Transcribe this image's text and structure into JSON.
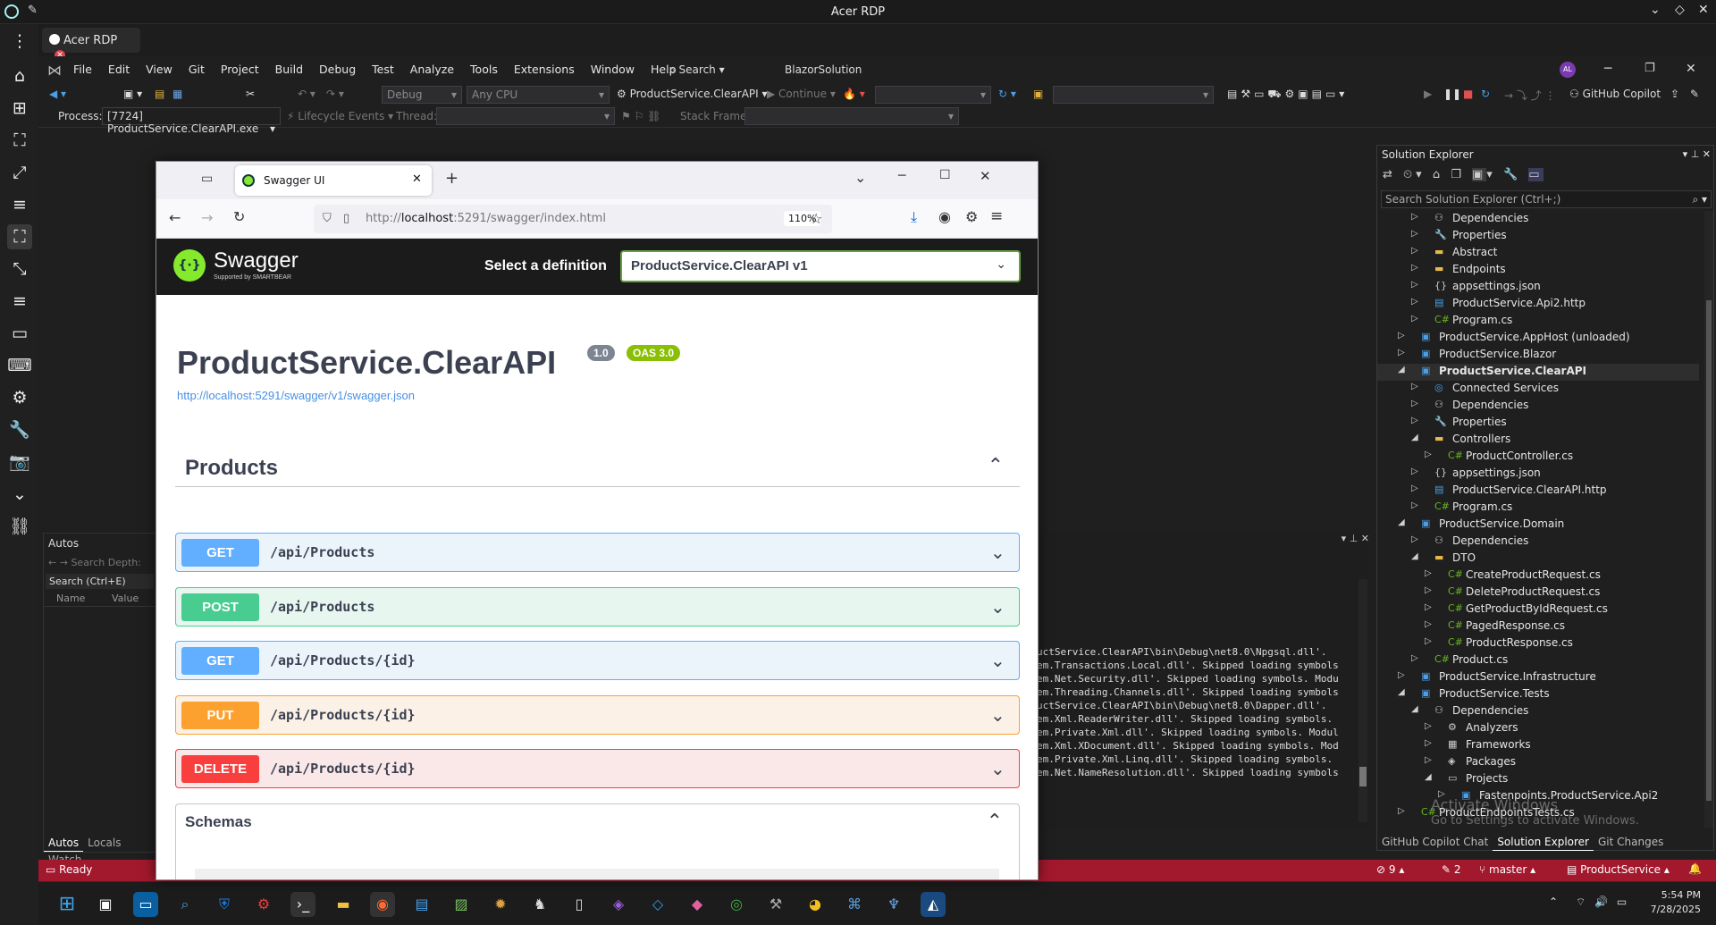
{
  "rdp": {
    "title": "Acer RDP",
    "tab_label": "Acer RDP"
  },
  "vs": {
    "menu": [
      "File",
      "Edit",
      "View",
      "Git",
      "Project",
      "Build",
      "Debug",
      "Test",
      "Analyze",
      "Tools",
      "Extensions",
      "Window",
      "Help"
    ],
    "search_label": "Search",
    "solution_name": "BlazorSolution",
    "avatar_initials": "AL",
    "config": "Debug",
    "platform": "Any CPU",
    "startup_project": "ProductService.ClearAPI",
    "continue_label": "Continue",
    "copilot_label": "GitHub Copilot",
    "process_label": "Process:",
    "process_value": "[7724] ProductService.ClearAPI.exe",
    "lifecycle_label": "Lifecycle Events",
    "thread_label": "Thread:",
    "stack_label": "Stack Frame:"
  },
  "solution_explorer": {
    "title": "Solution Explorer",
    "search_placeholder": "Search Solution Explorer (Ctrl+;)",
    "items": [
      {
        "label": "Dependencies",
        "depth": 2,
        "icon": "dependencies-icon"
      },
      {
        "label": "Properties",
        "depth": 2,
        "icon": "properties-icon"
      },
      {
        "label": "Abstract",
        "depth": 2,
        "icon": "folder-icon"
      },
      {
        "label": "Endpoints",
        "depth": 2,
        "icon": "folder-icon"
      },
      {
        "label": "appsettings.json",
        "depth": 2,
        "icon": "json-file-icon"
      },
      {
        "label": "ProductService.Api2.http",
        "depth": 2,
        "icon": "http-file-icon"
      },
      {
        "label": "Program.cs",
        "depth": 2,
        "icon": "csharp-file-icon"
      },
      {
        "label": "ProductService.AppHost (unloaded)",
        "depth": 1,
        "icon": "project-icon"
      },
      {
        "label": "ProductService.Blazor",
        "depth": 1,
        "icon": "project-icon"
      },
      {
        "label": "ProductService.ClearAPI",
        "depth": 1,
        "icon": "project-icon",
        "selected": true
      },
      {
        "label": "Connected Services",
        "depth": 2,
        "icon": "connected-services-icon"
      },
      {
        "label": "Dependencies",
        "depth": 2,
        "icon": "dependencies-icon"
      },
      {
        "label": "Properties",
        "depth": 2,
        "icon": "properties-icon"
      },
      {
        "label": "Controllers",
        "depth": 2,
        "icon": "folder-icon"
      },
      {
        "label": "ProductController.cs",
        "depth": 3,
        "icon": "csharp-file-icon"
      },
      {
        "label": "appsettings.json",
        "depth": 2,
        "icon": "json-file-icon"
      },
      {
        "label": "ProductService.ClearAPI.http",
        "depth": 2,
        "icon": "http-file-icon"
      },
      {
        "label": "Program.cs",
        "depth": 2,
        "icon": "csharp-file-icon"
      },
      {
        "label": "ProductService.Domain",
        "depth": 1,
        "icon": "project-icon"
      },
      {
        "label": "Dependencies",
        "depth": 2,
        "icon": "dependencies-icon"
      },
      {
        "label": "DTO",
        "depth": 2,
        "icon": "folder-icon"
      },
      {
        "label": "CreateProductRequest.cs",
        "depth": 3,
        "icon": "csharp-file-icon"
      },
      {
        "label": "DeleteProductRequest.cs",
        "depth": 3,
        "icon": "csharp-file-icon"
      },
      {
        "label": "GetProductByIdRequest.cs",
        "depth": 3,
        "icon": "csharp-file-icon"
      },
      {
        "label": "PagedResponse.cs",
        "depth": 3,
        "icon": "csharp-file-icon"
      },
      {
        "label": "ProductResponse.cs",
        "depth": 3,
        "icon": "csharp-file-icon"
      },
      {
        "label": "Product.cs",
        "depth": 2,
        "icon": "csharp-file-icon"
      },
      {
        "label": "ProductService.Infrastructure",
        "depth": 1,
        "icon": "project-icon"
      },
      {
        "label": "ProductService.Tests",
        "depth": 1,
        "icon": "project-icon"
      },
      {
        "label": "Dependencies",
        "depth": 2,
        "icon": "dependencies-icon"
      },
      {
        "label": "Analyzers",
        "depth": 3,
        "icon": "analyzer-icon"
      },
      {
        "label": "Frameworks",
        "depth": 3,
        "icon": "framework-icon"
      },
      {
        "label": "Packages",
        "depth": 3,
        "icon": "package-icon"
      },
      {
        "label": "Projects",
        "depth": 3,
        "icon": "projects-icon"
      },
      {
        "label": "Fastenpoints.ProductService.Api2",
        "depth": 4,
        "icon": "project-icon"
      },
      {
        "label": "ProductEndpointsTests.cs",
        "depth": 1,
        "icon": "csharp-file-icon"
      }
    ],
    "watermark_1": "Activate Windows",
    "watermark_2": "Go to Settings to activate Windows.",
    "bottom_tabs": [
      "GitHub Copilot Chat",
      "Solution Explorer",
      "Git Changes"
    ]
  },
  "autos": {
    "title": "Autos",
    "search_depth": "Search Depth:",
    "search": "Search (Ctrl+E)",
    "col_name": "Name",
    "col_value": "Value",
    "tabs": [
      "Autos",
      "Locals",
      "Watch"
    ]
  },
  "output": {
    "lines": [
      "uctService.ClearAPI\\bin\\Debug\\net8.0\\Npgsql.dll'. ",
      "em.Transactions.Local.dll'. Skipped loading symbols",
      "em.Net.Security.dll'. Skipped loading symbols. Modu",
      "em.Threading.Channels.dll'. Skipped loading symbols",
      "uctService.ClearAPI\\bin\\Debug\\net8.0\\Dapper.dll'. ",
      "em.Xml.ReaderWriter.dll'. Skipped loading symbols. ",
      "em.Private.Xml.dll'. Skipped loading symbols. Modul",
      "em.Xml.XDocument.dll'. Skipped loading symbols. Mod",
      "em.Private.Xml.Linq.dll'. Skipped loading symbols. ",
      "em.Net.NameResolution.dll'. Skipped loading symbols"
    ]
  },
  "status": {
    "ready": "Ready",
    "errors": "9",
    "edits": "2",
    "branch": "master",
    "repo": "ProductService"
  },
  "taskbar": {
    "time": "5:54 PM",
    "date": "7/28/2025"
  },
  "firefox": {
    "tab_title": "Swagger UI",
    "url_prefix": "http://",
    "url_host": "localhost",
    "url_rest": ":5291/swagger/index.html",
    "zoom": "110%"
  },
  "swagger": {
    "brand": "Swagger",
    "brand_sub": "Supported by SMARTBEAR",
    "select_label": "Select a definition",
    "definition": "ProductService.ClearAPI v1",
    "api_title": "ProductService.ClearAPI",
    "version_badge": "1.0",
    "oas_badge": "OAS 3.0",
    "spec_url": "http://localhost:5291/swagger/v1/swagger.json",
    "section": "Products",
    "operations": [
      {
        "method": "GET",
        "path": "/api/Products",
        "color": "#61affe",
        "bg": "#ebf3fb"
      },
      {
        "method": "POST",
        "path": "/api/Products",
        "color": "#49cc90",
        "bg": "#e8f6f0"
      },
      {
        "method": "GET",
        "path": "/api/Products/{id}",
        "color": "#61affe",
        "bg": "#ebf3fb"
      },
      {
        "method": "PUT",
        "path": "/api/Products/{id}",
        "color": "#fca130",
        "bg": "#fbf1e6"
      },
      {
        "method": "DELETE",
        "path": "/api/Products/{id}",
        "color": "#f93e3e",
        "bg": "#fae7e7"
      }
    ],
    "schemas": "Schemas"
  }
}
